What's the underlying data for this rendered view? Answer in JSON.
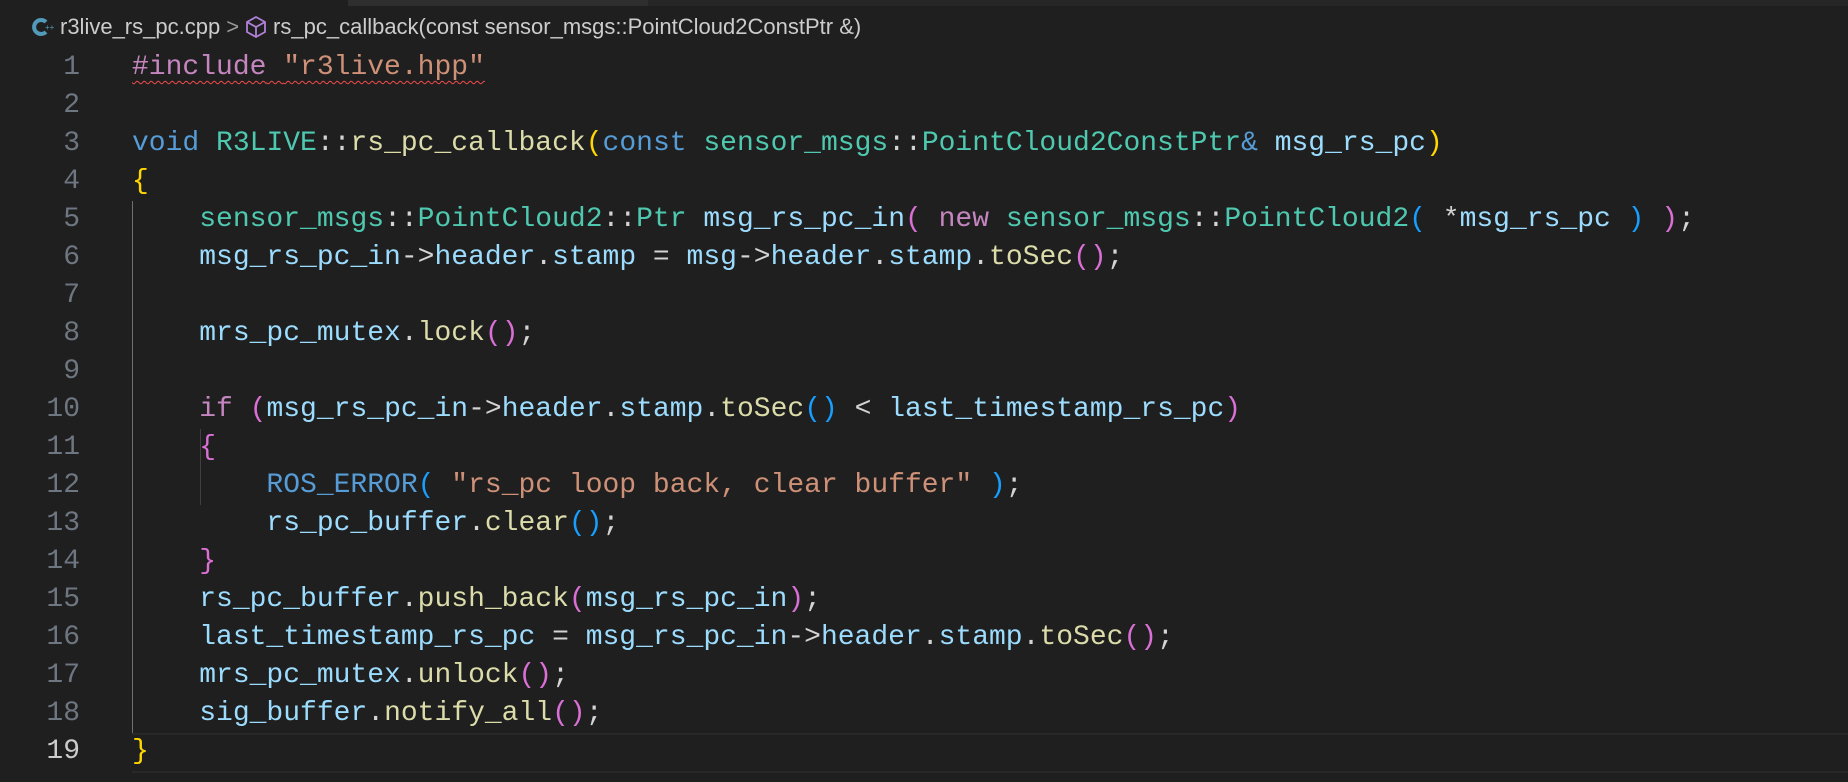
{
  "breadcrumb": {
    "file": "r3live_rs_pc.cpp",
    "separator": ">",
    "symbol": "rs_pc_callback(const sensor_msgs::PointCloud2ConstPtr &)"
  },
  "editor": {
    "current_line": 19,
    "lines": [
      {
        "n": "1",
        "squiggle": true,
        "tokens": [
          [
            "#include",
            "ctrl"
          ],
          [
            " ",
            "t"
          ],
          [
            "\"r3live.hpp\"",
            "str"
          ]
        ]
      },
      {
        "n": "2",
        "tokens": []
      },
      {
        "n": "3",
        "tokens": [
          [
            "void",
            "kw"
          ],
          [
            " ",
            "t"
          ],
          [
            "R3LIVE",
            "type"
          ],
          [
            "::",
            "t"
          ],
          [
            "rs_pc_callback",
            "fn"
          ],
          [
            "(",
            "b1"
          ],
          [
            "const",
            "kw"
          ],
          [
            " ",
            "t"
          ],
          [
            "sensor_msgs",
            "type"
          ],
          [
            "::",
            "t"
          ],
          [
            "PointCloud2ConstPtr",
            "type"
          ],
          [
            "&",
            "kw"
          ],
          [
            " ",
            "t"
          ],
          [
            "msg_rs_pc",
            "var"
          ],
          [
            ")",
            "b1"
          ]
        ]
      },
      {
        "n": "4",
        "tokens": [
          [
            "{",
            "b1"
          ]
        ]
      },
      {
        "n": "5",
        "tokens": [
          [
            "    ",
            "t"
          ],
          [
            "sensor_msgs",
            "type"
          ],
          [
            "::",
            "t"
          ],
          [
            "PointCloud2",
            "type"
          ],
          [
            "::",
            "t"
          ],
          [
            "Ptr",
            "type"
          ],
          [
            " ",
            "t"
          ],
          [
            "msg_rs_pc_in",
            "var"
          ],
          [
            "(",
            "b2"
          ],
          [
            " ",
            "t"
          ],
          [
            "new",
            "ctrl"
          ],
          [
            " ",
            "t"
          ],
          [
            "sensor_msgs",
            "type"
          ],
          [
            "::",
            "t"
          ],
          [
            "PointCloud2",
            "type"
          ],
          [
            "(",
            "b3"
          ],
          [
            " *",
            "t"
          ],
          [
            "msg_rs_pc",
            "var"
          ],
          [
            " ",
            "t"
          ],
          [
            ")",
            "b3"
          ],
          [
            " ",
            "t"
          ],
          [
            ")",
            "b2"
          ],
          [
            ";",
            "t"
          ]
        ]
      },
      {
        "n": "6",
        "tokens": [
          [
            "    ",
            "t"
          ],
          [
            "msg_rs_pc_in",
            "var"
          ],
          [
            "->",
            "t"
          ],
          [
            "header",
            "var"
          ],
          [
            ".",
            "t"
          ],
          [
            "stamp",
            "var"
          ],
          [
            " = ",
            "t"
          ],
          [
            "msg",
            "var"
          ],
          [
            "->",
            "t"
          ],
          [
            "header",
            "var"
          ],
          [
            ".",
            "t"
          ],
          [
            "stamp",
            "var"
          ],
          [
            ".",
            "t"
          ],
          [
            "toSec",
            "fn"
          ],
          [
            "()",
            "b2"
          ],
          [
            ";",
            "t"
          ]
        ]
      },
      {
        "n": "7",
        "tokens": []
      },
      {
        "n": "8",
        "tokens": [
          [
            "    ",
            "t"
          ],
          [
            "mrs_pc_mutex",
            "var"
          ],
          [
            ".",
            "t"
          ],
          [
            "lock",
            "fn"
          ],
          [
            "()",
            "b2"
          ],
          [
            ";",
            "t"
          ]
        ]
      },
      {
        "n": "9",
        "tokens": []
      },
      {
        "n": "10",
        "tokens": [
          [
            "    ",
            "t"
          ],
          [
            "if",
            "ctrl"
          ],
          [
            " ",
            "t"
          ],
          [
            "(",
            "b2"
          ],
          [
            "msg_rs_pc_in",
            "var"
          ],
          [
            "->",
            "t"
          ],
          [
            "header",
            "var"
          ],
          [
            ".",
            "t"
          ],
          [
            "stamp",
            "var"
          ],
          [
            ".",
            "t"
          ],
          [
            "toSec",
            "fn"
          ],
          [
            "()",
            "b3"
          ],
          [
            " < ",
            "t"
          ],
          [
            "last_timestamp_rs_pc",
            "var"
          ],
          [
            ")",
            "b2"
          ]
        ]
      },
      {
        "n": "11",
        "tokens": [
          [
            "    ",
            "t"
          ],
          [
            "{",
            "b2"
          ]
        ]
      },
      {
        "n": "12",
        "tokens": [
          [
            "        ",
            "t"
          ],
          [
            "ROS_ERROR",
            "mac"
          ],
          [
            "(",
            "b3"
          ],
          [
            " ",
            "t"
          ],
          [
            "\"rs_pc loop back, clear buffer\"",
            "str"
          ],
          [
            " ",
            "t"
          ],
          [
            ")",
            "b3"
          ],
          [
            ";",
            "t"
          ]
        ]
      },
      {
        "n": "13",
        "tokens": [
          [
            "        ",
            "t"
          ],
          [
            "rs_pc_buffer",
            "var"
          ],
          [
            ".",
            "t"
          ],
          [
            "clear",
            "fn"
          ],
          [
            "()",
            "b3"
          ],
          [
            ";",
            "t"
          ]
        ]
      },
      {
        "n": "14",
        "tokens": [
          [
            "    ",
            "t"
          ],
          [
            "}",
            "b2"
          ]
        ]
      },
      {
        "n": "15",
        "tokens": [
          [
            "    ",
            "t"
          ],
          [
            "rs_pc_buffer",
            "var"
          ],
          [
            ".",
            "t"
          ],
          [
            "push_back",
            "fn"
          ],
          [
            "(",
            "b2"
          ],
          [
            "msg_rs_pc_in",
            "var"
          ],
          [
            ")",
            "b2"
          ],
          [
            ";",
            "t"
          ]
        ]
      },
      {
        "n": "16",
        "tokens": [
          [
            "    ",
            "t"
          ],
          [
            "last_timestamp_rs_pc",
            "var"
          ],
          [
            " = ",
            "t"
          ],
          [
            "msg_rs_pc_in",
            "var"
          ],
          [
            "->",
            "t"
          ],
          [
            "header",
            "var"
          ],
          [
            ".",
            "t"
          ],
          [
            "stamp",
            "var"
          ],
          [
            ".",
            "t"
          ],
          [
            "toSec",
            "fn"
          ],
          [
            "()",
            "b2"
          ],
          [
            ";",
            "t"
          ]
        ]
      },
      {
        "n": "17",
        "tokens": [
          [
            "    ",
            "t"
          ],
          [
            "mrs_pc_mutex",
            "var"
          ],
          [
            ".",
            "t"
          ],
          [
            "unlock",
            "fn"
          ],
          [
            "()",
            "b2"
          ],
          [
            ";",
            "t"
          ]
        ]
      },
      {
        "n": "18",
        "tokens": [
          [
            "    ",
            "t"
          ],
          [
            "sig_buffer",
            "var"
          ],
          [
            ".",
            "t"
          ],
          [
            "notify_all",
            "fn"
          ],
          [
            "()",
            "b2"
          ],
          [
            ";",
            "t"
          ]
        ]
      },
      {
        "n": "19",
        "tokens": [
          [
            "}",
            "b1"
          ]
        ]
      }
    ]
  }
}
